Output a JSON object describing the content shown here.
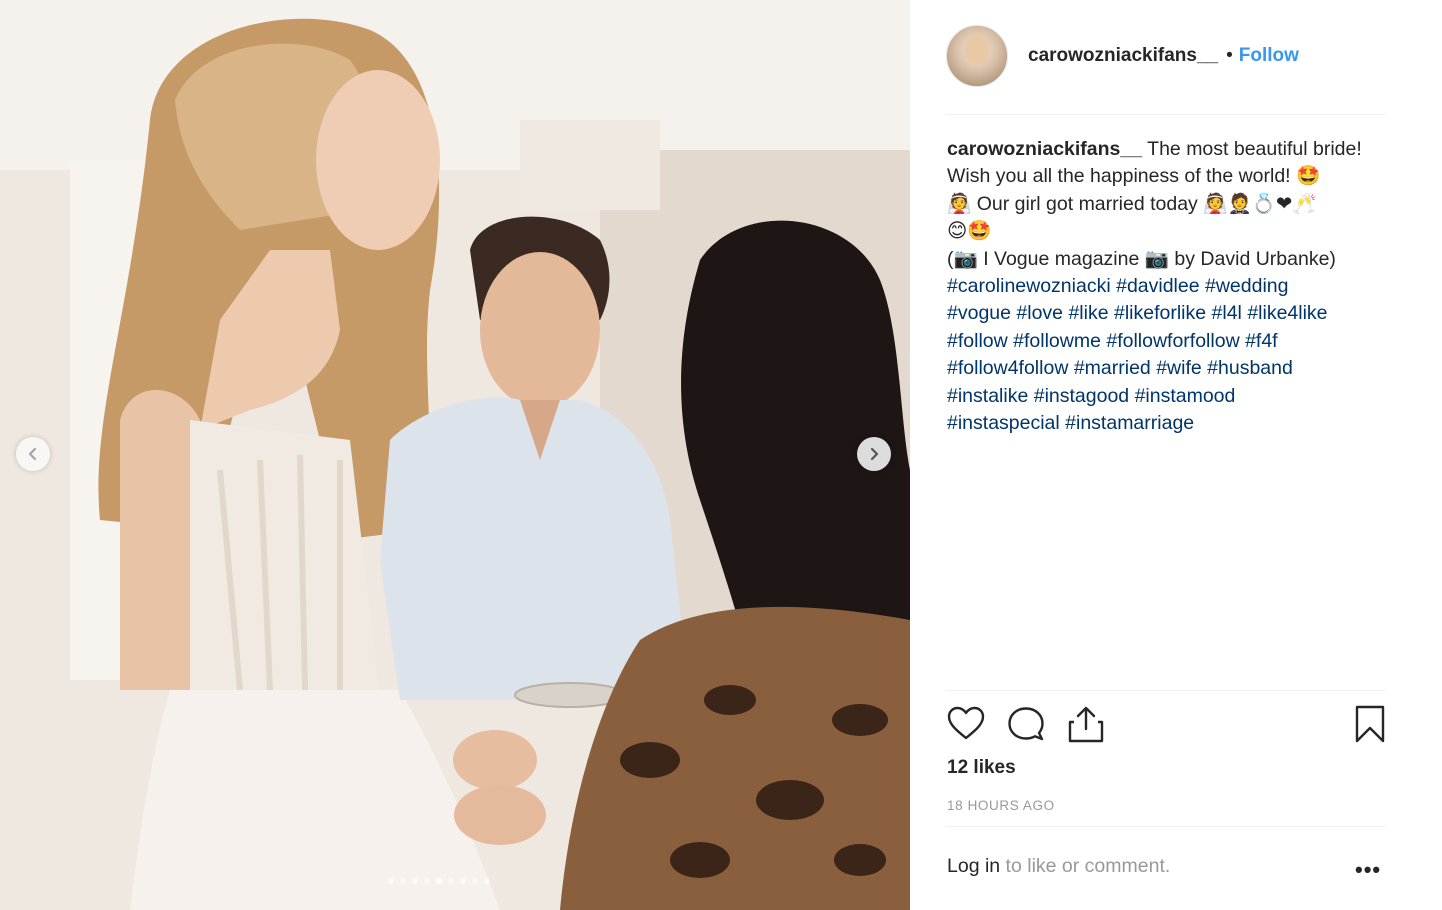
{
  "post": {
    "username": "carowozniackifans__",
    "separator": "•",
    "follow_label": "Follow",
    "caption": {
      "username": "carowozniackifans__",
      "line1": "The most beautiful bride!",
      "line2": "Wish you all the happiness of the world! 🤩",
      "line3": "👰 Our girl got married today 👰🤵💍❤🥂",
      "line4": "😊🤩",
      "line5": "(📷 I Vogue magazine 📷 by David Urbanke)",
      "hashtag_lines": [
        [
          "#carolinewozniacki",
          "#davidlee",
          "#wedding"
        ],
        [
          "#vogue",
          "#love",
          "#like",
          "#likeforlike",
          "#l4l",
          "#like4like"
        ],
        [
          "#follow",
          "#followme",
          "#followforfollow",
          "#f4f"
        ],
        [
          "#follow4follow",
          "#married",
          "#wife",
          "#husband"
        ],
        [
          "#instalike",
          "#instagood",
          "#instamood"
        ],
        [
          "#instaspecial",
          "#instamarriage"
        ]
      ]
    },
    "likes_text": "12 likes",
    "time_ago": "18 HOURS AGO",
    "login_link": "Log in",
    "login_suffix": " to like or comment.",
    "more_label": "•••"
  },
  "carousel": {
    "total_slides": 9,
    "active_slide": 4
  },
  "icons": {
    "prev": "chevron-left-icon",
    "next": "chevron-right-icon",
    "like": "heart-icon",
    "comment": "comment-bubble-icon",
    "share": "share-icon",
    "save": "bookmark-icon"
  },
  "colors": {
    "follow": "#3897f0",
    "hashtag": "#003569",
    "muted": "#999999",
    "text": "#262626"
  }
}
